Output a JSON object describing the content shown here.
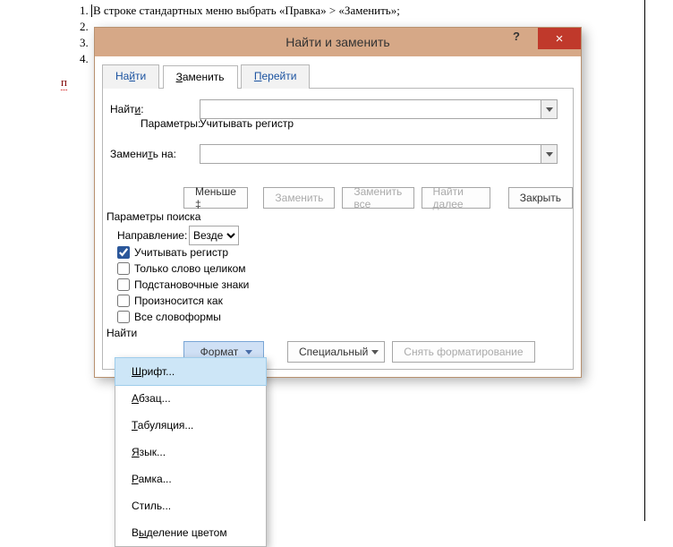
{
  "document": {
    "list_item_1": "В строке стандартных меню выбрать «Правка» > «Заменить»;",
    "nums": [
      "2",
      "3",
      "4"
    ],
    "pilcrow": "п"
  },
  "dialog": {
    "title": "Найти и заменить",
    "help": "?",
    "close": "×",
    "tabs": {
      "find_pre": "На",
      "find_u": "й",
      "find_post": "ти",
      "replace_pre": "",
      "replace_u": "З",
      "replace_post": "аменить",
      "goto_pre": "",
      "goto_u": "П",
      "goto_post": "ерейти"
    },
    "find_label_pre": "Найт",
    "find_label_u": "и",
    "find_label_post": ":",
    "options_label": "Параметры:",
    "options_value": "Учитывать регистр",
    "replaceWith_pre": "Замени",
    "replaceWith_u": "т",
    "replaceWith_post": "ь на:",
    "buttons": {
      "less": "Меньше  ‡",
      "replace": "Заменить",
      "replaceAll": "Заменить все",
      "findNext": "Найти далее",
      "close": "Закрыть",
      "format": "Формат",
      "special": "Специальный",
      "noformat": "Снять форматирование"
    },
    "searchOptions": {
      "title": "Параметры поиска",
      "direction_label": "Направление:",
      "direction_value": "Везде",
      "matchCase": "Учитывать регистр",
      "wholeWord": "Только слово целиком",
      "wildcards": "Подстановочные знаки",
      "soundsLike": "Произносится как",
      "wordForms": "Все словоформы",
      "findSection": "Найти"
    }
  },
  "formatMenu": {
    "font_u": "Ш",
    "font_post": "рифт...",
    "para_u": "А",
    "para_post": "бзац...",
    "tabs_u": "Т",
    "tabs_post": "абуляция...",
    "lang_u": "Я",
    "lang_post": "зык...",
    "frame_u": "Р",
    "frame_post": "амка...",
    "style": "Стиль...",
    "highlight_pre": "В",
    "highlight_u": "ы",
    "highlight_post": "деление цветом"
  }
}
